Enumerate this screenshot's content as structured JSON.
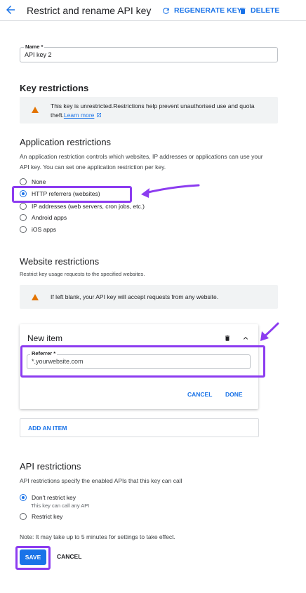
{
  "header": {
    "title": "Restrict and rename API key",
    "regenerate_label": "REGENERATE KEY",
    "delete_label": "DELETE"
  },
  "name_field": {
    "label": "Name *",
    "value": "API key 2"
  },
  "key_restrictions": {
    "heading": "Key restrictions",
    "warning_text": "This key is unrestricted.Restrictions help prevent unauthorised use and quota",
    "warning_text_2": "theft.",
    "learn_more": "Learn more"
  },
  "application_restrictions": {
    "heading": "Application restrictions",
    "description_line1": "An application restriction controls which websites, IP addresses or applications can use your",
    "description_line2": "API key. You can set one application restriction per key.",
    "options": [
      "None",
      "HTTP referrers (websites)",
      "IP addresses (web servers, cron jobs, etc.)",
      "Android apps",
      "iOS apps"
    ],
    "selected": "HTTP referrers (websites)"
  },
  "website_restrictions": {
    "heading": "Website restrictions",
    "description": "Restrict key usage requests to the specified websites.",
    "warning_text": "If left blank, your API key will accept requests from any website.",
    "new_item": {
      "title": "New item",
      "referrer_label": "Referrer *",
      "referrer_value": "*.yourwebsite.com",
      "cancel_label": "CANCEL",
      "done_label": "DONE"
    },
    "add_item_label": "ADD AN ITEM"
  },
  "api_restrictions": {
    "heading": "API restrictions",
    "description": "API restrictions specify the enabled APIs that this key can call",
    "options": [
      "Don't restrict key",
      "Restrict key"
    ],
    "selected": "Don't restrict key",
    "dont_restrict_sub": "This key can call any API"
  },
  "note": "Note: It may take up to 5 minutes for settings to take effect.",
  "footer": {
    "save_label": "SAVE",
    "cancel_label": "CANCEL"
  },
  "colors": {
    "accent": "#1a73e8",
    "warning": "#e37400",
    "highlight": "#8c3cf0"
  }
}
